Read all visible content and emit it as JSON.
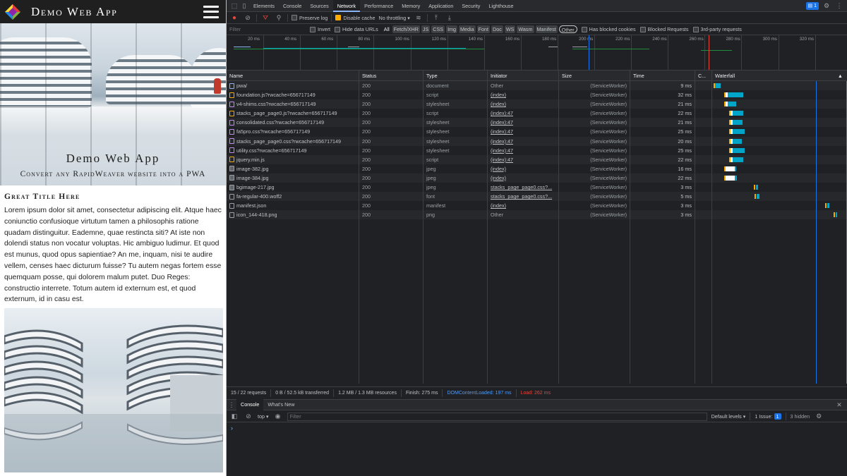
{
  "app": {
    "title": "Demo Web App",
    "hero_title": "Demo Web App",
    "hero_subtitle": "Convert any RapidWeaver website into a PWA",
    "content_title": "Great Title Here",
    "content_text": "Lorem ipsum dolor sit amet, consectetur adipiscing elit. Atque haec coniunctio confusioque virtutum tamen a philosophis ratione quadam distinguitur. Eademne, quae restincta siti? At iste non dolendi status non vocatur voluptas. Hic ambiguo ludimur. Et quod est munus, quod opus sapientiae? An me, inquam, nisi te audire vellem, censes haec dicturum fuisse? Tu autem negas fortem esse quemquam posse, qui dolorem malum putet. Duo Reges: constructio interrete. Totum autem id externum est, et quod externum, id in casu est."
  },
  "devtools": {
    "tabs": [
      "Elements",
      "Console",
      "Sources",
      "Network",
      "Performance",
      "Memory",
      "Application",
      "Security",
      "Lighthouse"
    ],
    "active_tab": "Network",
    "issues_count": "1",
    "toolbar": {
      "preserve_log": "Preserve log",
      "disable_cache": "Disable cache",
      "throttling": "No throttling"
    },
    "filter": {
      "placeholder": "Filter",
      "invert": "Invert",
      "hide_data_urls": "Hide data URLs",
      "types": [
        "All",
        "Fetch/XHR",
        "JS",
        "CSS",
        "Img",
        "Media",
        "Font",
        "Doc",
        "WS",
        "Wasm",
        "Manifest",
        "Other"
      ],
      "selected_type": "Other",
      "has_blocked_cookies": "Has blocked cookies",
      "blocked_requests": "Blocked Requests",
      "third_party": "3rd-party requests"
    },
    "overview_ticks": [
      "20 ms",
      "40 ms",
      "60 ms",
      "80 ms",
      "100 ms",
      "120 ms",
      "140 ms",
      "160 ms",
      "180 ms",
      "200 ms",
      "220 ms",
      "240 ms",
      "260 ms",
      "280 ms",
      "300 ms",
      "320 ms"
    ],
    "columns": {
      "name": "Name",
      "status": "Status",
      "type": "Type",
      "initiator": "Initiator",
      "size": "Size",
      "time": "Time",
      "c": "C...",
      "waterfall": "Waterfall"
    },
    "rows": [
      {
        "name": "pwa/",
        "status": "200",
        "type": "document",
        "initiator": "Other",
        "size": "(ServiceWorker)",
        "time": "9 ms",
        "icon": "doc",
        "wf_start": 4,
        "wf_wait": 0,
        "wf_dur": 9
      },
      {
        "name": "foundation.js?rwcache=656717149",
        "status": "200",
        "type": "script",
        "initiator": "(index)",
        "size": "(ServiceWorker)",
        "time": "32 ms",
        "icon": "script",
        "wf_start": 20,
        "wf_wait": 4,
        "wf_dur": 28
      },
      {
        "name": "v4-shims.css?rwcache=656717149",
        "status": "200",
        "type": "stylesheet",
        "initiator": "(index)",
        "size": "(ServiceWorker)",
        "time": "21 ms",
        "icon": "style",
        "wf_start": 20,
        "wf_wait": 4,
        "wf_dur": 17
      },
      {
        "name": "stacks_page_page0.js?rwcache=656717149",
        "status": "200",
        "type": "script",
        "initiator": "(index):47",
        "size": "(ServiceWorker)",
        "time": "22 ms",
        "icon": "script",
        "wf_start": 28,
        "wf_wait": 3,
        "wf_dur": 19
      },
      {
        "name": "consolidated.css?rwcache=656717149",
        "status": "200",
        "type": "stylesheet",
        "initiator": "(index):47",
        "size": "(ServiceWorker)",
        "time": "21 ms",
        "icon": "style",
        "wf_start": 28,
        "wf_wait": 3,
        "wf_dur": 18
      },
      {
        "name": "fa5pro.css?rwcache=656717149",
        "status": "200",
        "type": "stylesheet",
        "initiator": "(index):47",
        "size": "(ServiceWorker)",
        "time": "25 ms",
        "icon": "style",
        "wf_start": 28,
        "wf_wait": 3,
        "wf_dur": 22
      },
      {
        "name": "stacks_page_page0.css?rwcache=656717149",
        "status": "200",
        "type": "stylesheet",
        "initiator": "(index):47",
        "size": "(ServiceWorker)",
        "time": "20 ms",
        "icon": "style",
        "wf_start": 28,
        "wf_wait": 3,
        "wf_dur": 17
      },
      {
        "name": "utility.css?rwcache=656717149",
        "status": "200",
        "type": "stylesheet",
        "initiator": "(index):47",
        "size": "(ServiceWorker)",
        "time": "25 ms",
        "icon": "style",
        "wf_start": 28,
        "wf_wait": 3,
        "wf_dur": 22
      },
      {
        "name": "jquery.min.js",
        "status": "200",
        "type": "script",
        "initiator": "(index):47",
        "size": "(ServiceWorker)",
        "time": "22 ms",
        "icon": "script",
        "wf_start": 28,
        "wf_wait": 3,
        "wf_dur": 19
      },
      {
        "name": "image-382.jpg",
        "status": "200",
        "type": "jpeg",
        "initiator": "(index)",
        "size": "(ServiceWorker)",
        "time": "16 ms",
        "icon": "img",
        "wf_start": 20,
        "wf_wait": 14,
        "wf_dur": 14
      },
      {
        "name": "image-384.jpg",
        "status": "200",
        "type": "jpeg",
        "initiator": "(index)",
        "size": "(ServiceWorker)",
        "time": "22 ms",
        "icon": "img",
        "wf_start": 20,
        "wf_wait": 14,
        "wf_dur": 18
      },
      {
        "name": "bgimage-217.jpg",
        "status": "200",
        "type": "jpeg",
        "initiator": "stacks_page_page0.css?...",
        "size": "(ServiceWorker)",
        "time": "3 ms",
        "icon": "img",
        "wf_start": 66,
        "wf_wait": 1,
        "wf_dur": 4
      },
      {
        "name": "fa-regular-400.woff2",
        "status": "200",
        "type": "font",
        "initiator": "stacks_page_page0.css?...",
        "size": "(ServiceWorker)",
        "time": "5 ms",
        "icon": "font",
        "wf_start": 67,
        "wf_wait": 1,
        "wf_dur": 5
      },
      {
        "name": "manifest.json",
        "status": "200",
        "type": "manifest",
        "initiator": "(index)",
        "size": "(ServiceWorker)",
        "time": "3 ms",
        "icon": "other",
        "wf_start": 175,
        "wf_wait": 1,
        "wf_dur": 4
      },
      {
        "name": "icon_144-418.png",
        "status": "200",
        "type": "png",
        "initiator": "Other",
        "size": "(ServiceWorker)",
        "time": "3 ms",
        "icon": "other",
        "wf_start": 188,
        "wf_wait": 1,
        "wf_dur": 3
      }
    ],
    "status": {
      "requests": "15 / 22 requests",
      "transferred": "0 B / 52.5 kB transferred",
      "resources": "1.2 MB / 1.3 MB resources",
      "finish": "Finish: 275 ms",
      "dcl": "DOMContentLoaded: 197 ms",
      "load": "Load: 262 ms"
    },
    "drawer": {
      "tabs": [
        "Console",
        "What's New"
      ],
      "context": "top",
      "filter_placeholder": "Filter",
      "levels": "Default levels",
      "issue": "1 Issue:",
      "issue_count": "1",
      "hidden": "3 hidden"
    },
    "colors": {
      "dcl": "#1a73e8",
      "load": "#e8453c",
      "bar": "#00a5c7"
    }
  }
}
